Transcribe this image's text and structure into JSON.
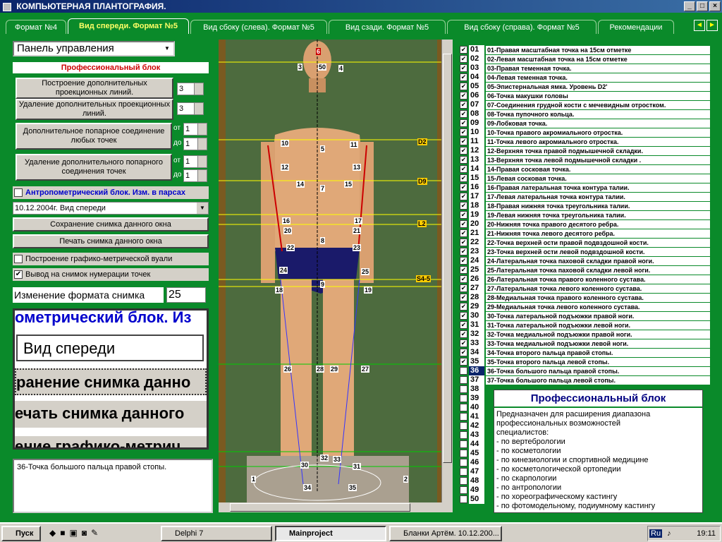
{
  "window": {
    "title": "КОМПЬЮТЕРНАЯ ПЛАНТОГРАФИЯ."
  },
  "tabs": [
    {
      "label": "Формат №4"
    },
    {
      "label": "Вид спереди. Формат №5"
    },
    {
      "label": "Вид сбоку (слева). Формат №5"
    },
    {
      "label": "Вид сзади. Формат №5"
    },
    {
      "label": "Вид сбоку (справа). Формат №5"
    },
    {
      "label": "Рекомендации"
    }
  ],
  "panel": {
    "selector": "Панель управления",
    "prof_header": "Профессиональный блок",
    "btn_build_lines": "Построение дополнительных проекционных линий.",
    "btn_delete_lines": "Удаление дополнительных проекционных линий.",
    "btn_add_pair": "Дополнительное попарное соединение любых точек",
    "btn_del_pair": "Удаление дополнительного попарного соединения точек",
    "spin_build": "3",
    "spin_delete": "3",
    "from_label": "от",
    "to_label": "до",
    "spin_from1": "1",
    "spin_to1": "1",
    "spin_from2": "1",
    "spin_to2": "1",
    "anthro_check": "Антропометрический блок. Изм. в парсах",
    "combo_value": "10.12.2004г. Вид спереди",
    "btn_save": "Сохранение снимка данного окна",
    "btn_print": "Печать снимка данного окна",
    "chk_graph": "Построение графико-метрической вуали",
    "chk_numbering": "Вывод на снимок нумерации точек",
    "format_label": "Изменение формата снимка",
    "format_value": "25",
    "zoom_rows": [
      "ометрический блок. Из",
      "Вид спереди",
      "ранение снимка данно",
      "ечать снимка данного",
      "ение графико-метрич"
    ],
    "status_text": "36-Точка большого пальца правой стопы."
  },
  "photo_labels": {
    "p6": "6",
    "p3": "3",
    "p50": "50",
    "p4": "4",
    "p10": "10",
    "p5": "5",
    "p11": "11",
    "d2": "D2",
    "p12": "12",
    "p13": "13",
    "p14": "14",
    "p7": "7",
    "p15": "15",
    "d9": "D9",
    "p16": "16",
    "p17": "17",
    "p20": "20",
    "p21": "21",
    "l2": "L2",
    "p8": "8",
    "p22": "22",
    "p23": "23",
    "p24": "24",
    "p25": "25",
    "s45": "S4-5",
    "p9": "9",
    "p18": "18",
    "p19": "19",
    "p26": "26",
    "p28": "28",
    "p29": "29",
    "p27": "27",
    "p32": "32",
    "p33": "33",
    "p30": "30",
    "p31": "31",
    "p34": "34",
    "p35": "35",
    "p1": "1",
    "p2": "2"
  },
  "points": [
    {
      "n": "01",
      "checked": true,
      "desc": "01-Правая масштабная точка на 15см отметке"
    },
    {
      "n": "02",
      "checked": true,
      "desc": "02-Левая масштабная точка на 15см отметке"
    },
    {
      "n": "03",
      "checked": true,
      "desc": "03-Правая теменная точка."
    },
    {
      "n": "04",
      "checked": true,
      "desc": "04-Левая теменная точка."
    },
    {
      "n": "05",
      "checked": true,
      "desc": "05-Эпистернальная ямка. Уровень D2'"
    },
    {
      "n": "06",
      "checked": true,
      "desc": "06-Точка макушки головы"
    },
    {
      "n": "07",
      "checked": true,
      "desc": "07-Соединения грудной кости с мечевидным отростком."
    },
    {
      "n": "08",
      "checked": true,
      "desc": "08-Точка пупочного кольца."
    },
    {
      "n": "09",
      "checked": true,
      "desc": "09-Лобковая точка."
    },
    {
      "n": "10",
      "checked": true,
      "desc": "10-Точка правого акромиального отростка."
    },
    {
      "n": "11",
      "checked": true,
      "desc": "11-Точка левого акромиального отростка."
    },
    {
      "n": "12",
      "checked": true,
      "desc": "12-Верхняя точка правой подмышечной складки."
    },
    {
      "n": "13",
      "checked": true,
      "desc": "13-Верхняя точка левой подмышечной складки ."
    },
    {
      "n": "14",
      "checked": true,
      "desc": "14-Правая сосковая точка."
    },
    {
      "n": "15",
      "checked": true,
      "desc": "15-Левая сосковая точка."
    },
    {
      "n": "16",
      "checked": true,
      "desc": "16-Правая латеральная точка  контура талии."
    },
    {
      "n": "17",
      "checked": true,
      "desc": "17-Левая латеральная точка  контура талии."
    },
    {
      "n": "18",
      "checked": true,
      "desc": "18-Правая нижняя точка  треугольника талии."
    },
    {
      "n": "19",
      "checked": true,
      "desc": "19-Левая нижняя точка треугольника талии."
    },
    {
      "n": "20",
      "checked": true,
      "desc": "20-Нижняя точка правого десятого ребра."
    },
    {
      "n": "21",
      "checked": true,
      "desc": "21-Нижняя точка левого десятого ребра."
    },
    {
      "n": "22",
      "checked": true,
      "desc": "22-Точка верхней ости правой подвздошной кости."
    },
    {
      "n": "23",
      "checked": true,
      "desc": "23-Точка верхней ости левой подвздошной кости."
    },
    {
      "n": "24",
      "checked": true,
      "desc": "24-Латеральная точка паховой складки правой ноги."
    },
    {
      "n": "25",
      "checked": true,
      "desc": "25-Латеральная точка паховой складки левой ноги."
    },
    {
      "n": "26",
      "checked": true,
      "desc": "26-Латеральная точка правого коленного сустава."
    },
    {
      "n": "27",
      "checked": true,
      "desc": "27-Латеральная точка левого коленного сустава."
    },
    {
      "n": "28",
      "checked": true,
      "desc": "28-Медиальная точка правого коленного сустава."
    },
    {
      "n": "29",
      "checked": true,
      "desc": "29-Медиальная точка левого коленного сустава."
    },
    {
      "n": "30",
      "checked": true,
      "desc": "30-Точка латеральной подъюжки правой ноги."
    },
    {
      "n": "31",
      "checked": true,
      "desc": "31-Точка латеральной подъюжки левой ноги."
    },
    {
      "n": "32",
      "checked": true,
      "desc": "32-Точка медиальной подъюжки правой ноги."
    },
    {
      "n": "33",
      "checked": true,
      "desc": "33-Точка медиальной подъюжки левой ноги."
    },
    {
      "n": "34",
      "checked": true,
      "desc": "34-Точка второго пальца правой стопы."
    },
    {
      "n": "35",
      "checked": true,
      "desc": "35-Точка второго пальца левой стопы."
    },
    {
      "n": "36",
      "checked": false,
      "desc": "36-Точка большого пальца правой стопы.",
      "selected": true
    },
    {
      "n": "37",
      "checked": false,
      "desc": "37-Точка большого пальца левой стопы."
    },
    {
      "n": "38",
      "checked": false,
      "desc": ""
    },
    {
      "n": "39",
      "checked": false,
      "desc": ""
    },
    {
      "n": "40",
      "checked": false,
      "desc": ""
    },
    {
      "n": "41",
      "checked": false,
      "desc": ""
    },
    {
      "n": "42",
      "checked": false,
      "desc": ""
    },
    {
      "n": "43",
      "checked": false,
      "desc": ""
    },
    {
      "n": "44",
      "checked": false,
      "desc": ""
    },
    {
      "n": "45",
      "checked": false,
      "desc": ""
    },
    {
      "n": "46",
      "checked": false,
      "desc": ""
    },
    {
      "n": "47",
      "checked": false,
      "desc": ""
    },
    {
      "n": "48",
      "checked": false,
      "desc": ""
    },
    {
      "n": "49",
      "checked": false,
      "desc": ""
    },
    {
      "n": "50",
      "checked": false,
      "desc": ""
    }
  ],
  "info": {
    "title": "Профессиональный блок",
    "lines": [
      "Предназначен для расширения диапазона",
      "профессиональных возможностей",
      "специалистов:",
      "- по вертебрологии",
      "- по косметологии",
      "- по кинезиологии и спортивной медицине",
      "- по косметологической ортопедии",
      "- по скарпологии",
      "- по антропологии",
      "- по хореографическому кастингу",
      "- по фотомодельному, подиумному кастингу"
    ]
  },
  "taskbar": {
    "start": "Пуск",
    "items": [
      "Delphi 7",
      "Mainproject",
      "Бланки Артём. 10.12.200..."
    ],
    "lang": "Ru",
    "time": "19:11"
  }
}
